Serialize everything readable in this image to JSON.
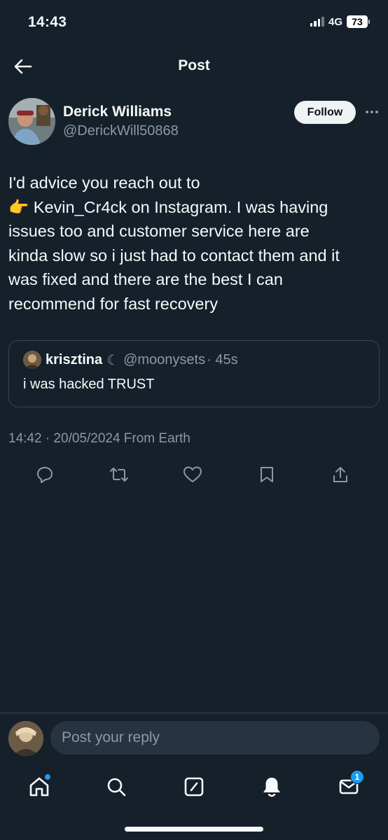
{
  "status_bar": {
    "time": "14:43",
    "network": "4G",
    "battery": "73"
  },
  "header": {
    "title": "Post"
  },
  "author": {
    "name": "Derick Williams",
    "handle": "@DerickWill50868",
    "follow_label": "Follow"
  },
  "post": {
    "text_lines": [
      "I'd advice you reach out to",
      "👉 Kevin_Cr4ck on Instagram. I was having",
      "issues too and customer service here are",
      "kinda slow so i just had to contact them and it",
      "was fixed and there are the best I can",
      "recommend for fast recovery"
    ],
    "meta": "14:42 · 20/05/2024 From Earth"
  },
  "quote": {
    "name": "krisztina",
    "moon": "☾",
    "handle": "@moonysets",
    "time": "· 45s",
    "text": "i was hacked TRUST"
  },
  "actions": [
    "reply-icon",
    "repost-icon",
    "like-icon",
    "bookmark-icon",
    "share-icon"
  ],
  "reply": {
    "placeholder": "Post your reply"
  },
  "tab_bar": {
    "items": [
      "home-icon",
      "search-icon",
      "compose-icon",
      "notifications-icon",
      "messages-icon"
    ],
    "messages_badge": "1"
  },
  "colors": {
    "background": "#15202b",
    "accent": "#1d9bf0",
    "muted": "#8b98a5",
    "border": "#38444d"
  }
}
